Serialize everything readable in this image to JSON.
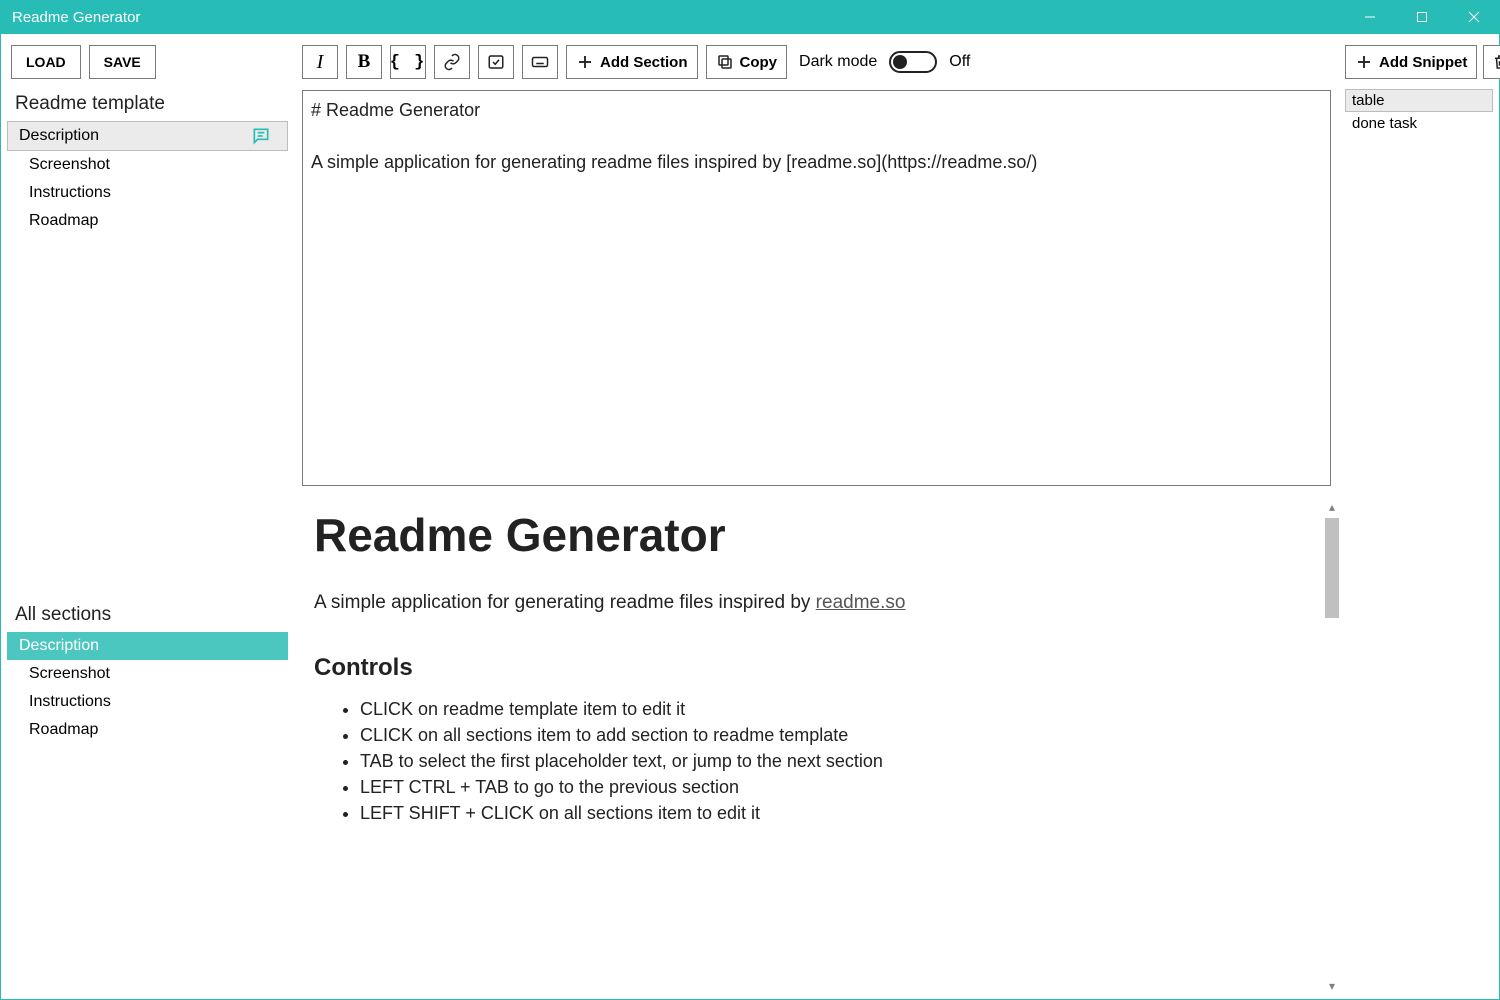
{
  "window": {
    "title": "Readme Generator"
  },
  "file": {
    "load": "LOAD",
    "save": "SAVE"
  },
  "sidebar": {
    "template_heading": "Readme template",
    "template_items": [
      "Description",
      "Screenshot",
      "Instructions",
      "Roadmap"
    ],
    "template_active_index": 0,
    "all_heading": "All sections",
    "all_items": [
      "Description",
      "Screenshot",
      "Instructions",
      "Roadmap"
    ],
    "all_active_index": 0
  },
  "toolbar": {
    "add_section": "Add Section",
    "copy": "Copy",
    "dark_mode_label": "Dark mode",
    "dark_mode_state": "Off"
  },
  "editor": {
    "content": "# Readme Generator\n\nA simple application for generating readme files inspired by [readme.so](https://readme.so/)"
  },
  "preview": {
    "h1": "Readme Generator",
    "lead_prefix": "A simple application for generating readme files inspired by ",
    "lead_link_text": "readme.so",
    "controls_heading": "Controls",
    "controls": [
      "CLICK on readme template item to edit it",
      "CLICK on all sections item to add section to readme template",
      "TAB to select the first placeholder text, or jump to the next section",
      "LEFT CTRL + TAB to go to the previous section",
      "LEFT SHIFT + CLICK on all sections item to edit it"
    ]
  },
  "right": {
    "add_snippet": "Add Snippet",
    "snippets": [
      "table",
      "done task"
    ],
    "selected_index": 0
  }
}
